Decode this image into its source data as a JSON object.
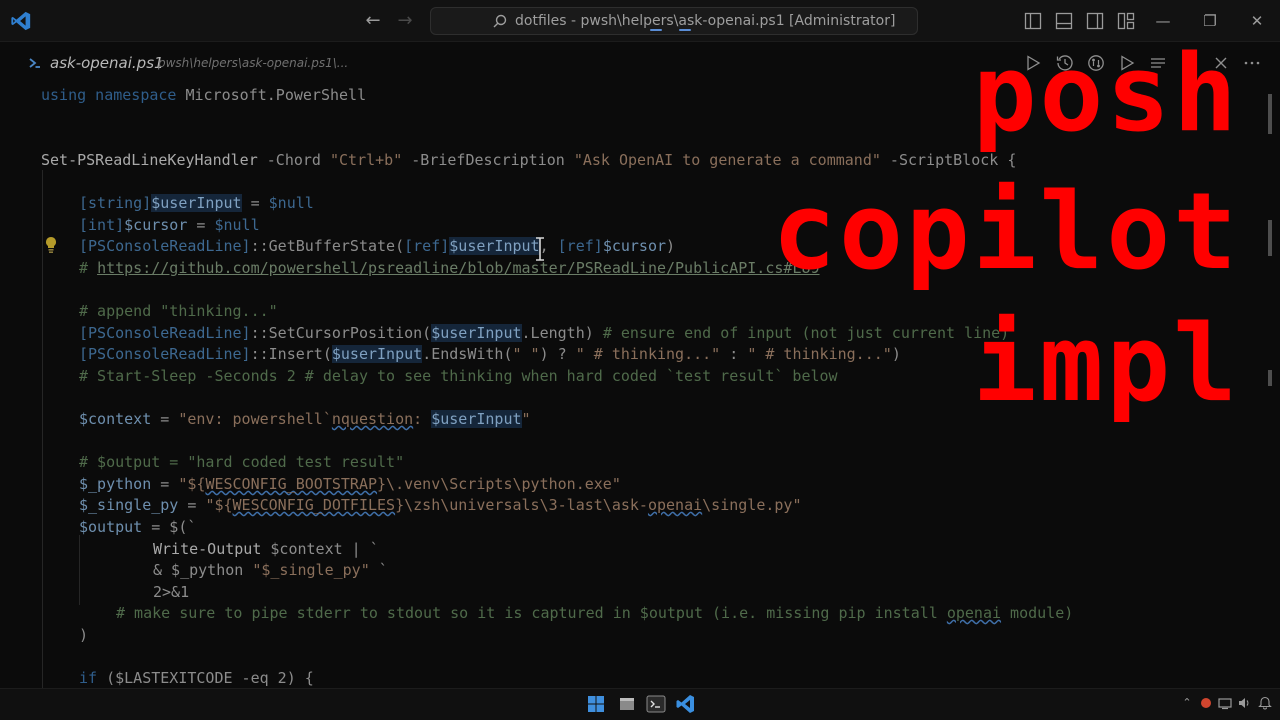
{
  "titlebar": {
    "command_center_text": "dotfiles - pwsh\\helpers\\ask-openai.ps1 [Administrator]"
  },
  "tab": {
    "file_name": "ask-openai.ps1",
    "breadcrumb": "pwsh\\helpers\\ask-openai.ps1\\..."
  },
  "overlay": {
    "lines": [
      "posh",
      "copilot",
      "impl"
    ],
    "color": "#ff0000"
  },
  "code": {
    "l1": {
      "kw": "using namespace",
      "rest": " Microsoft.PowerShell"
    },
    "l2": {
      "fn": "Set-PSReadLineKeyHandler",
      "p1": " -Chord ",
      "s1": "\"Ctrl+b\"",
      "p2": " -BriefDescription ",
      "s2": "\"Ask OpenAI to generate a command\"",
      "p3": " -ScriptBlock {"
    },
    "l3": {
      "t": "[string]",
      "v": "$userInput",
      "p": " = ",
      "n": "$null"
    },
    "l4": {
      "t": "[int]",
      "v": "$cursor",
      "p": " = ",
      "n": "$null"
    },
    "l5": {
      "t": "[PSConsoleReadLine]",
      "p1": "::GetBufferState(",
      "t2": "[ref]",
      "v": "$userInput",
      "p2": ", ",
      "t3": "[ref]",
      "v2": "$cursor",
      "p3": ")"
    },
    "l6": {
      "c": "# ",
      "link": "https://github.com/powershell/psreadline/blob/master/PSReadLine/PublicAPI.cs#L89"
    },
    "l7": {
      "c": "# append \"thinking...\""
    },
    "l8": {
      "t": "[PSConsoleReadLine]",
      "p1": "::SetCursorPosition(",
      "v": "$userInput",
      "p2": ".Length) ",
      "c": "# ensure end of input (not just current line)"
    },
    "l9": {
      "t": "[PSConsoleReadLine]",
      "p1": "::Insert(",
      "v": "$userInput",
      "p2": ".EndsWith(",
      "s1": "\" \"",
      "p3": ") ? ",
      "s2": "\" # thinking...\"",
      "p4": " : ",
      "s3": "\" # thinking...\"",
      "p5": ")"
    },
    "l10": {
      "c": "# Start-Sleep -Seconds 2 # delay to see thinking when hard coded `test result` below"
    },
    "l11": {
      "v": "$context",
      "p": " = ",
      "s1": "\"env: powershell`",
      "sq": "nquestion",
      "s2": ": ",
      "v2": "$userInput",
      "s3": "\""
    },
    "l12": {
      "c": "# $output = \"hard coded test result\""
    },
    "l13": {
      "v": "$_python",
      "p": " = ",
      "s1": "\"${",
      "sq": "WESCONFIG_BOOTSTRAP",
      "s2": "}\\.venv\\Scripts\\python.exe\""
    },
    "l14": {
      "v": "$_single_py",
      "p": " = ",
      "s1": "\"${",
      "sq": "WESCONFIG_DOTFILES",
      "s2": "}\\zsh\\universals\\3-last\\ask-",
      "sq2": "openai",
      "s3": "\\single.py\""
    },
    "l15": {
      "v": "$output",
      "p": " = $(`"
    },
    "l16": {
      "fn": "Write-Output",
      "p": " $context | `"
    },
    "l17": {
      "p": "& $_python ",
      "s": "\"$_single_py\"",
      "p2": " `"
    },
    "l18": {
      "p": "2>&1"
    },
    "l19": {
      "c1": "# make sure to pipe stderr to stdout so it is captured in $output (i.e. missing pip install ",
      "sq": "openai",
      "c2": " module)"
    },
    "l20": {
      "p": ")"
    },
    "l21": {
      "kw": "if",
      "p": " ($LASTEXITCODE -eq 2) {"
    }
  }
}
